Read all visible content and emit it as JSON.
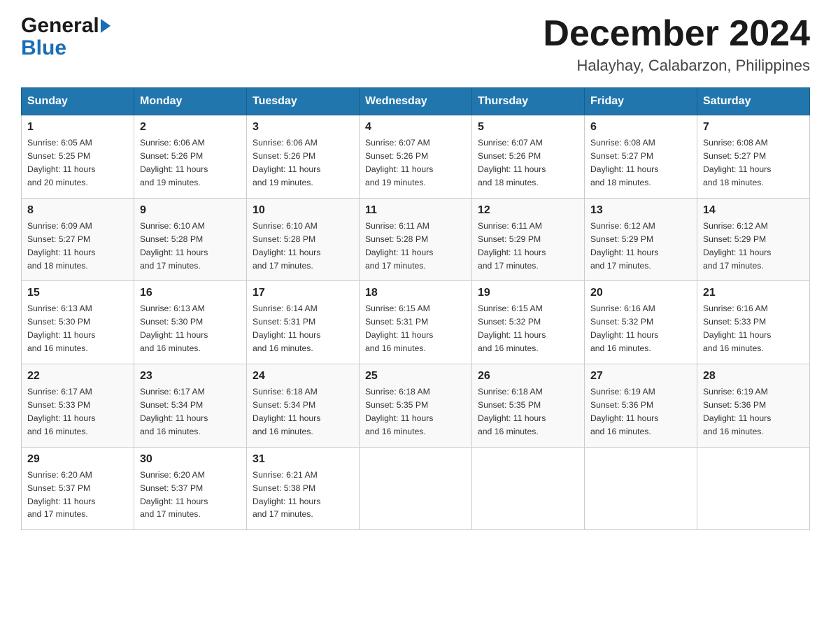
{
  "header": {
    "logo_general": "General",
    "logo_blue": "Blue",
    "title": "December 2024",
    "location": "Halayhay, Calabarzon, Philippines"
  },
  "days_of_week": [
    "Sunday",
    "Monday",
    "Tuesday",
    "Wednesday",
    "Thursday",
    "Friday",
    "Saturday"
  ],
  "weeks": [
    [
      {
        "day": "1",
        "sunrise": "6:05 AM",
        "sunset": "5:25 PM",
        "daylight": "11 hours and 20 minutes."
      },
      {
        "day": "2",
        "sunrise": "6:06 AM",
        "sunset": "5:26 PM",
        "daylight": "11 hours and 19 minutes."
      },
      {
        "day": "3",
        "sunrise": "6:06 AM",
        "sunset": "5:26 PM",
        "daylight": "11 hours and 19 minutes."
      },
      {
        "day": "4",
        "sunrise": "6:07 AM",
        "sunset": "5:26 PM",
        "daylight": "11 hours and 19 minutes."
      },
      {
        "day": "5",
        "sunrise": "6:07 AM",
        "sunset": "5:26 PM",
        "daylight": "11 hours and 18 minutes."
      },
      {
        "day": "6",
        "sunrise": "6:08 AM",
        "sunset": "5:27 PM",
        "daylight": "11 hours and 18 minutes."
      },
      {
        "day": "7",
        "sunrise": "6:08 AM",
        "sunset": "5:27 PM",
        "daylight": "11 hours and 18 minutes."
      }
    ],
    [
      {
        "day": "8",
        "sunrise": "6:09 AM",
        "sunset": "5:27 PM",
        "daylight": "11 hours and 18 minutes."
      },
      {
        "day": "9",
        "sunrise": "6:10 AM",
        "sunset": "5:28 PM",
        "daylight": "11 hours and 17 minutes."
      },
      {
        "day": "10",
        "sunrise": "6:10 AM",
        "sunset": "5:28 PM",
        "daylight": "11 hours and 17 minutes."
      },
      {
        "day": "11",
        "sunrise": "6:11 AM",
        "sunset": "5:28 PM",
        "daylight": "11 hours and 17 minutes."
      },
      {
        "day": "12",
        "sunrise": "6:11 AM",
        "sunset": "5:29 PM",
        "daylight": "11 hours and 17 minutes."
      },
      {
        "day": "13",
        "sunrise": "6:12 AM",
        "sunset": "5:29 PM",
        "daylight": "11 hours and 17 minutes."
      },
      {
        "day": "14",
        "sunrise": "6:12 AM",
        "sunset": "5:29 PM",
        "daylight": "11 hours and 17 minutes."
      }
    ],
    [
      {
        "day": "15",
        "sunrise": "6:13 AM",
        "sunset": "5:30 PM",
        "daylight": "11 hours and 16 minutes."
      },
      {
        "day": "16",
        "sunrise": "6:13 AM",
        "sunset": "5:30 PM",
        "daylight": "11 hours and 16 minutes."
      },
      {
        "day": "17",
        "sunrise": "6:14 AM",
        "sunset": "5:31 PM",
        "daylight": "11 hours and 16 minutes."
      },
      {
        "day": "18",
        "sunrise": "6:15 AM",
        "sunset": "5:31 PM",
        "daylight": "11 hours and 16 minutes."
      },
      {
        "day": "19",
        "sunrise": "6:15 AM",
        "sunset": "5:32 PM",
        "daylight": "11 hours and 16 minutes."
      },
      {
        "day": "20",
        "sunrise": "6:16 AM",
        "sunset": "5:32 PM",
        "daylight": "11 hours and 16 minutes."
      },
      {
        "day": "21",
        "sunrise": "6:16 AM",
        "sunset": "5:33 PM",
        "daylight": "11 hours and 16 minutes."
      }
    ],
    [
      {
        "day": "22",
        "sunrise": "6:17 AM",
        "sunset": "5:33 PM",
        "daylight": "11 hours and 16 minutes."
      },
      {
        "day": "23",
        "sunrise": "6:17 AM",
        "sunset": "5:34 PM",
        "daylight": "11 hours and 16 minutes."
      },
      {
        "day": "24",
        "sunrise": "6:18 AM",
        "sunset": "5:34 PM",
        "daylight": "11 hours and 16 minutes."
      },
      {
        "day": "25",
        "sunrise": "6:18 AM",
        "sunset": "5:35 PM",
        "daylight": "11 hours and 16 minutes."
      },
      {
        "day": "26",
        "sunrise": "6:18 AM",
        "sunset": "5:35 PM",
        "daylight": "11 hours and 16 minutes."
      },
      {
        "day": "27",
        "sunrise": "6:19 AM",
        "sunset": "5:36 PM",
        "daylight": "11 hours and 16 minutes."
      },
      {
        "day": "28",
        "sunrise": "6:19 AM",
        "sunset": "5:36 PM",
        "daylight": "11 hours and 16 minutes."
      }
    ],
    [
      {
        "day": "29",
        "sunrise": "6:20 AM",
        "sunset": "5:37 PM",
        "daylight": "11 hours and 17 minutes."
      },
      {
        "day": "30",
        "sunrise": "6:20 AM",
        "sunset": "5:37 PM",
        "daylight": "11 hours and 17 minutes."
      },
      {
        "day": "31",
        "sunrise": "6:21 AM",
        "sunset": "5:38 PM",
        "daylight": "11 hours and 17 minutes."
      },
      null,
      null,
      null,
      null
    ]
  ],
  "labels": {
    "sunrise": "Sunrise:",
    "sunset": "Sunset:",
    "daylight": "Daylight:"
  }
}
